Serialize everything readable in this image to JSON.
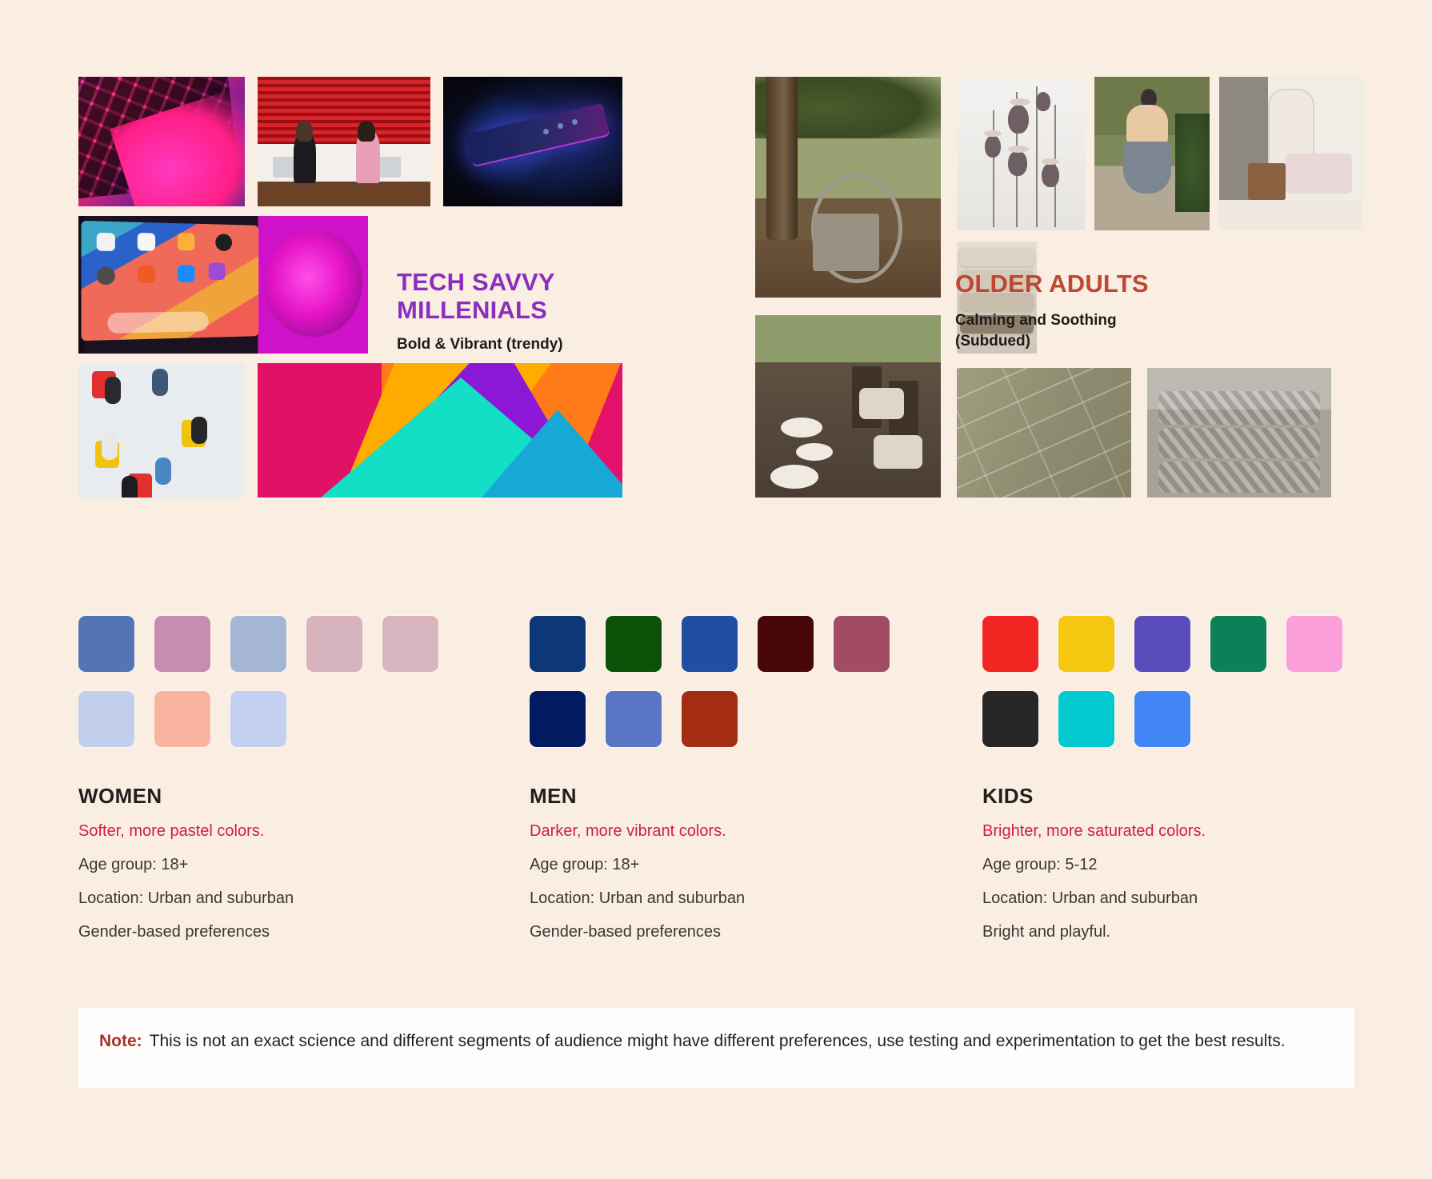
{
  "page": {
    "background_color": "#faeee2"
  },
  "moodboards": [
    {
      "id": "tech-savvy-millenials",
      "title": "TECH SAVVY MILLENIALS",
      "subtitle": "Bold & Vibrant (trendy)",
      "title_color": "#8b2fbe",
      "images": [
        {
          "name": "backlit-keyboard-photo"
        },
        {
          "name": "office-workers-red-blinds-photo"
        },
        {
          "name": "neon-smartphone-photo"
        },
        {
          "name": "tablet-neon-lamp-photo"
        },
        {
          "name": "overhead-meeting-photo"
        },
        {
          "name": "geometric-color-blocks-graphic"
        }
      ]
    },
    {
      "id": "older-adults",
      "title": "OLDER ADULTS",
      "subtitle": "Calming and Soothing (Subdued)",
      "title_color": "#bf4632",
      "images": [
        {
          "name": "oak-tree-hanging-chair-photo"
        },
        {
          "name": "dried-poppy-pods-photo"
        },
        {
          "name": "woman-garden-chicken-photo"
        },
        {
          "name": "pastel-living-room-photo"
        },
        {
          "name": "folded-linen-stack-photo"
        },
        {
          "name": "outdoor-dinner-table-photo"
        },
        {
          "name": "olive-brick-tile-photo"
        },
        {
          "name": "chunky-knit-blankets-photo"
        }
      ]
    }
  ],
  "palettes": [
    {
      "id": "women",
      "name": "WOMEN",
      "accent_text": "Softer, more pastel colors.",
      "accent_color": "#cf1f3c",
      "details": [
        "Age group: 18+",
        "Location: Urban and suburban",
        "Gender-based preferences"
      ],
      "swatches": [
        "#5375b4",
        "#c88bb2",
        "#a5b6d4",
        "#d6b3bd",
        "#d9b6bf",
        "#c2cfec",
        "#f9b3a1",
        "#c4d0ef"
      ]
    },
    {
      "id": "men",
      "name": "MEN",
      "accent_text": "Darker, more vibrant colors.",
      "accent_color": "#cf1f3c",
      "details": [
        "Age group: 18+",
        "Location: Urban and suburban",
        "Gender-based preferences"
      ],
      "swatches": [
        "#0c3878",
        "#0d5208",
        "#1f4ea3",
        "#470707",
        "#a24c64",
        "#021a60",
        "#5a75c4",
        "#a32c12"
      ]
    },
    {
      "id": "kids",
      "name": "KIDS",
      "accent_text": "Brighter, more saturated colors.",
      "accent_color": "#cf1f3c",
      "details": [
        "Age group: 5-12",
        "Location: Urban and suburban",
        "Bright and playful."
      ],
      "swatches": [
        "#f12623",
        "#f5c711",
        "#5a4cbb",
        "#0d805a",
        "#fc9fdb",
        "#282625",
        "#03c8cd",
        "#4285f4"
      ]
    }
  ],
  "note": {
    "label": "Note:",
    "text": "This is not an exact science and different segments of audience might have different preferences, use testing and experimentation to get the best results."
  }
}
